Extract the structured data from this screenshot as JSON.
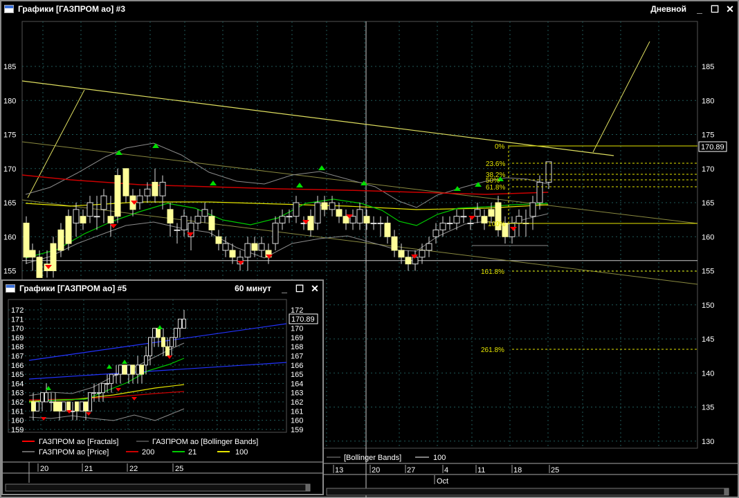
{
  "main_window": {
    "title": "Графики [ГАЗПРОМ ао] #3",
    "timeframe": "Дневной",
    "minimize_glyph": "_",
    "maximize_glyph": "☐",
    "close_glyph": "✕",
    "current_price": "170.89",
    "y_ticks": [
      "185",
      "180",
      "175",
      "170",
      "165",
      "160",
      "155",
      "150",
      "145",
      "140",
      "135",
      "130"
    ],
    "fib_labels": [
      "0%",
      "23.6%",
      "38.2%",
      "50%",
      "61.8%",
      "100%",
      "161.8%",
      "261.8%"
    ],
    "legend_partial": "[Bollinger Bands]",
    "legend_ma100": "100",
    "x_date_labels": [
      "13",
      "20",
      "27",
      "4",
      "11",
      "18",
      "25"
    ],
    "month_label": "Oct"
  },
  "sub_window": {
    "title": "Графики [ГАЗПРОМ ао] #5",
    "timeframe": "60 минут",
    "minimize_glyph": "_",
    "maximize_glyph": "☐",
    "close_glyph": "✕",
    "current_price": "170.89",
    "y_ticks": [
      "172",
      "171",
      "170",
      "169",
      "168",
      "167",
      "166",
      "165",
      "164",
      "163",
      "162",
      "161",
      "160",
      "159"
    ],
    "legend": {
      "fractals": "ГАЗПРОМ ао [Fractals]",
      "bollinger": "ГАЗПРОМ ао [Bollinger Bands]",
      "price": "ГАЗПРОМ ао [Price]",
      "ma200": "200",
      "ma21": "21",
      "ma100": "100"
    },
    "x_date_labels": [
      "20",
      "21",
      "22",
      "25"
    ]
  },
  "colors": {
    "candle_up": "#ffff99",
    "candle_down": "#ffff99",
    "fractal_up": "#00dd00",
    "fractal_down": "#ff0000",
    "ma200": "#cc0000",
    "ma21": "#00cc00",
    "ma100": "#e6e600",
    "bollinger": "#8c8c8c",
    "trendline": "#e0e060",
    "fib": "#e6e600",
    "grid": "#1f5a5a",
    "sub_channel": "#2233ff"
  }
}
